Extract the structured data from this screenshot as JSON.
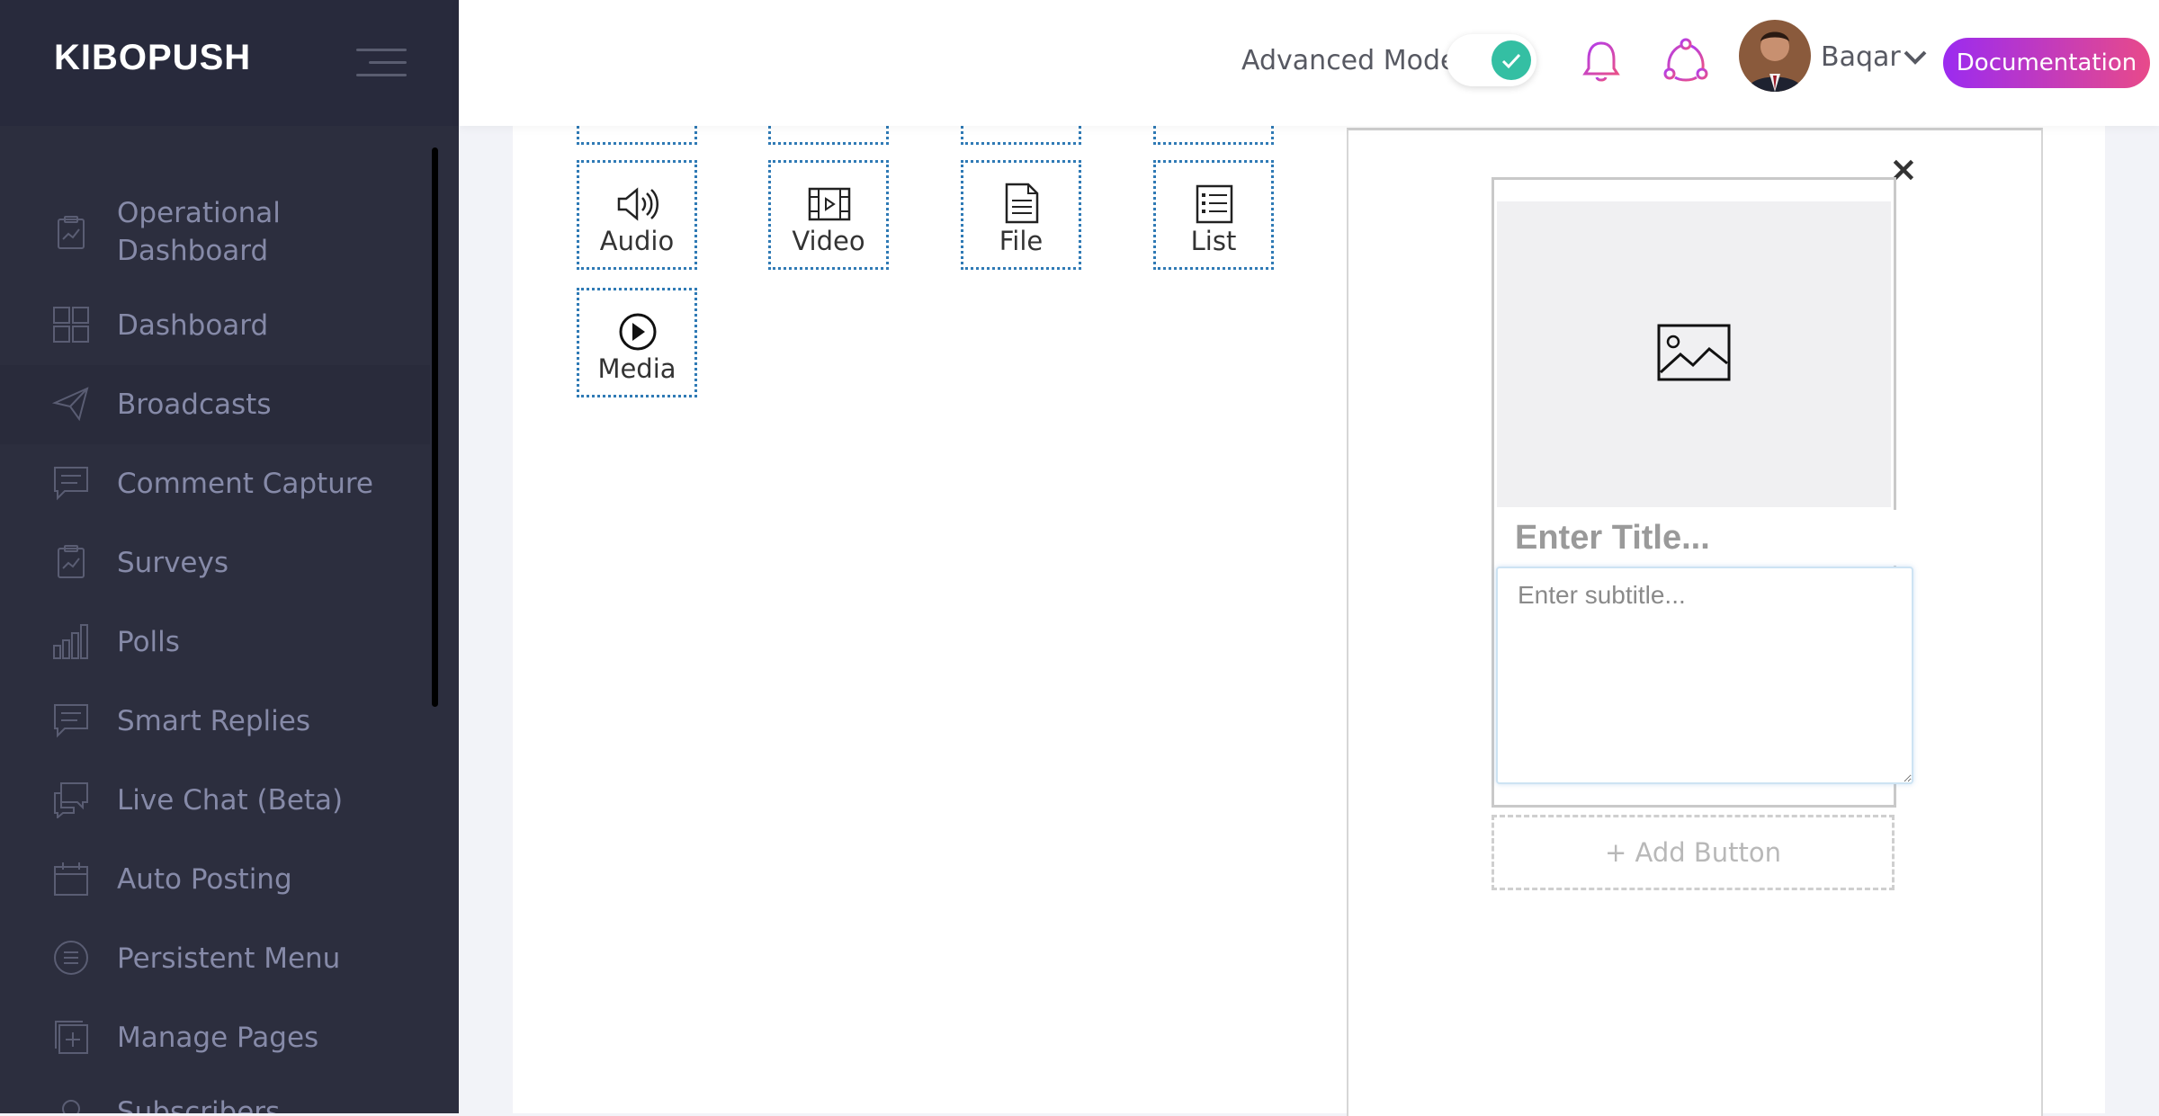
{
  "brand": {
    "name": "KIBOPUSH"
  },
  "sidebar": {
    "items": [
      {
        "label_line1": "Operational",
        "label_line2": "Dashboard",
        "icon": "clipboard-chart-icon"
      },
      {
        "label": "Dashboard",
        "icon": "grid-icon"
      },
      {
        "label": "Broadcasts",
        "icon": "paper-plane-icon"
      },
      {
        "label": "Comment Capture",
        "icon": "comment-icon"
      },
      {
        "label": "Surveys",
        "icon": "clipboard-chart-icon"
      },
      {
        "label": "Polls",
        "icon": "bar-chart-icon"
      },
      {
        "label": "Smart Replies",
        "icon": "comment-icon"
      },
      {
        "label": "Live Chat (Beta)",
        "icon": "chat-bubbles-icon"
      },
      {
        "label": "Auto Posting",
        "icon": "calendar-icon"
      },
      {
        "label": "Persistent Menu",
        "icon": "menu-circle-icon"
      },
      {
        "label": "Manage Pages",
        "icon": "add-page-icon"
      },
      {
        "label": "Subscribers",
        "icon": "user-icon"
      }
    ]
  },
  "header": {
    "advanced_mode_label": "Advanced Mode",
    "advanced_mode_on": true,
    "username": "Baqar",
    "documentation_label": "Documentation",
    "accent_color": "#34bfa3",
    "gradient": [
      "#9b2bf0",
      "#e84a8a"
    ]
  },
  "components": {
    "items": [
      {
        "label": "Audio",
        "icon": "speaker-icon"
      },
      {
        "label": "Video",
        "icon": "film-icon"
      },
      {
        "label": "File",
        "icon": "file-icon"
      },
      {
        "label": "List",
        "icon": "list-icon"
      },
      {
        "label": "Media",
        "icon": "play-circle-icon"
      }
    ]
  },
  "card": {
    "title_placeholder": "Enter Title...",
    "subtitle_placeholder": "Enter subtitle...",
    "add_button_label": "+ Add Button",
    "close_glyph": "×"
  }
}
